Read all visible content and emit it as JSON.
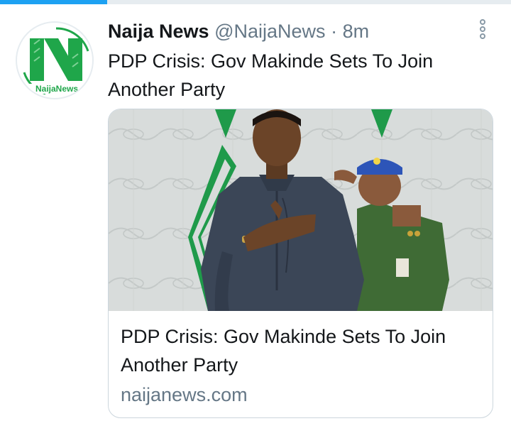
{
  "progress": {
    "fraction": 0.21,
    "color": "#1da1f2"
  },
  "tweet": {
    "author_name": "Naija News",
    "author_handle": "@NaijaNews",
    "separator": "·",
    "timestamp": "8m",
    "text": "PDP Crisis: Gov Makinde Sets To Join Another Party",
    "more_icon": "more-options-vertical-icon"
  },
  "avatar": {
    "logo_text": "NaijaNews",
    "brand_color": "#1fa64a"
  },
  "card": {
    "title": "PDP Crisis: Gov Makinde Sets To Join Another Party",
    "domain": "naijanews.com"
  },
  "colors": {
    "accent": "#1da1f2",
    "text": "#14171a",
    "muted": "#657786",
    "border": "#ccd6dd"
  }
}
